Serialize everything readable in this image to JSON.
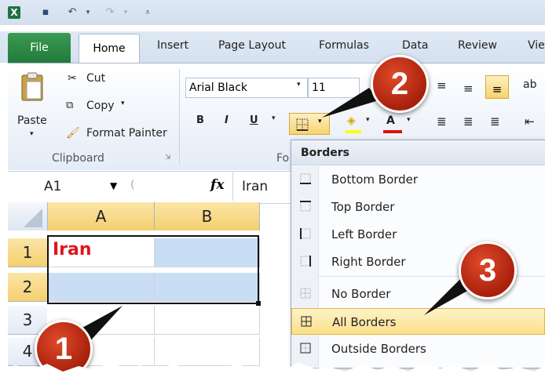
{
  "tabs": [
    "File",
    "Home",
    "Insert",
    "Page Layout",
    "Formulas",
    "Data",
    "Review",
    "Vie"
  ],
  "clipboard": {
    "paste": "Paste",
    "cut": "Cut",
    "copy": "Copy",
    "format_painter": "Format Painter",
    "group_label": "Clipboard"
  },
  "font": {
    "name": "Arial Black",
    "size": "11",
    "bold": "B",
    "italic": "I",
    "underline": "U",
    "group_label": "Fo"
  },
  "formula_bar": {
    "cell_ref": "A1",
    "fx": "fx",
    "content": "Iran"
  },
  "grid": {
    "columns": [
      "A",
      "B"
    ],
    "rows": [
      "1",
      "2",
      "3",
      "4"
    ],
    "cells": {
      "A1": "Iran"
    }
  },
  "borders_menu": {
    "title": "Borders",
    "items": [
      "Bottom Border",
      "Top Border",
      "Left Border",
      "Right Border",
      "No Border",
      "All Borders",
      "Outside Borders"
    ],
    "highlighted": "All Borders"
  },
  "callouts": [
    "1",
    "2",
    "3"
  ],
  "colors": {
    "accent_red": "#c8280e",
    "selected_cell": "#c9ddf5",
    "highlight": "#fbe08a",
    "excel_green": "#217346"
  }
}
